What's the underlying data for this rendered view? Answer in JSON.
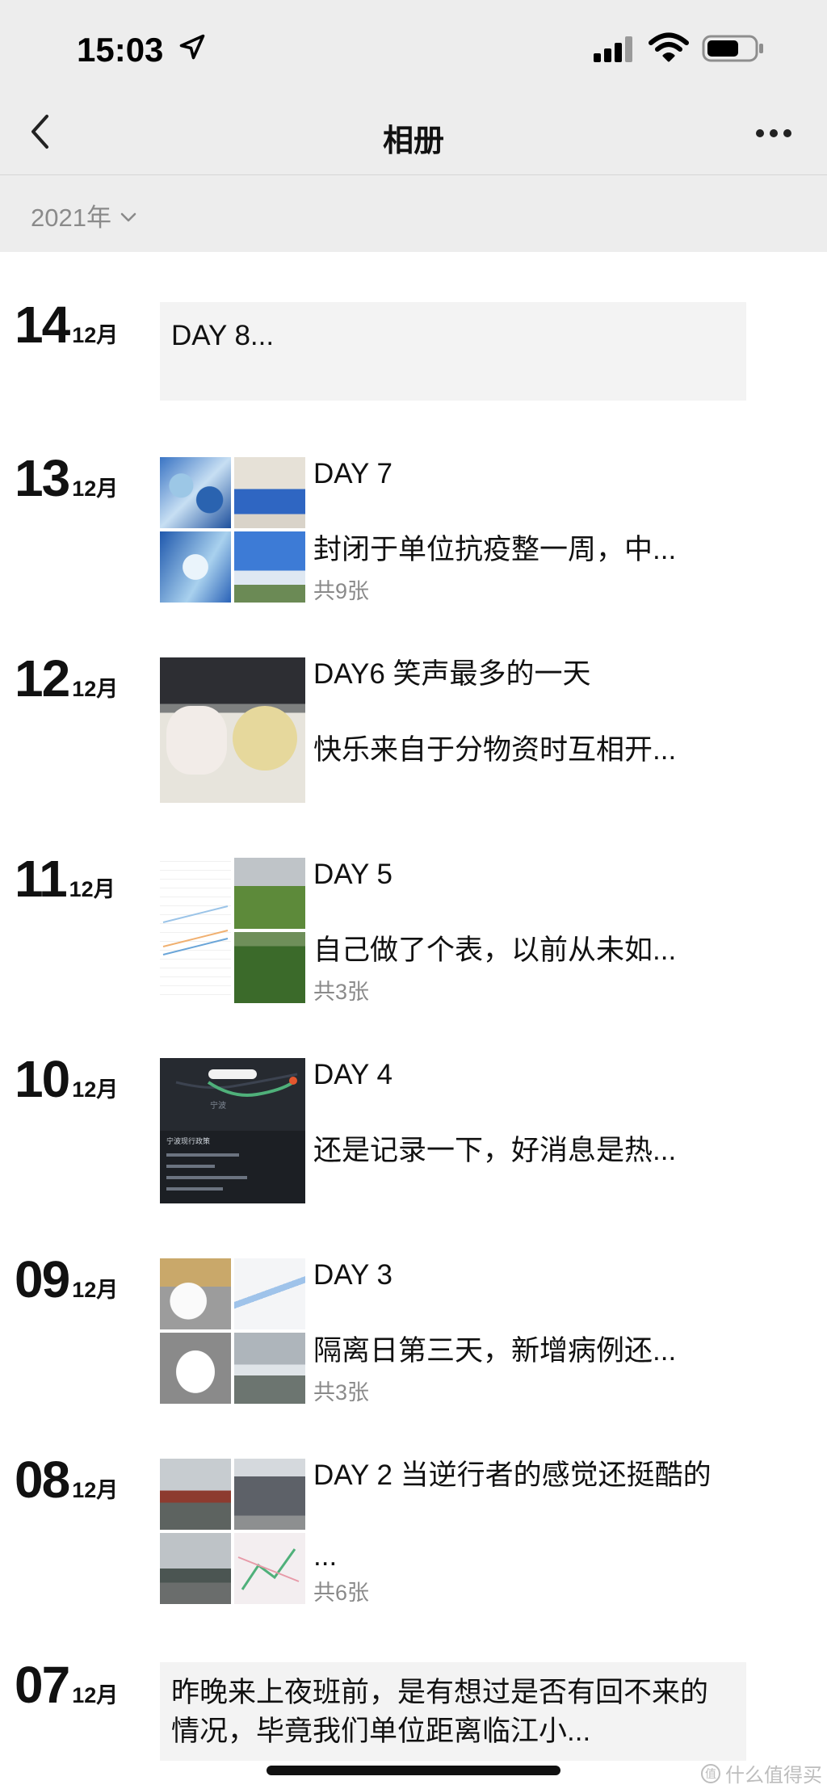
{
  "status_bar": {
    "time": "15:03"
  },
  "header": {
    "title": "相册"
  },
  "filter": {
    "year": "2021年"
  },
  "entries": [
    {
      "day": "14",
      "month": "12月",
      "text": "DAY 8..."
    },
    {
      "day": "13",
      "month": "12月",
      "title": "DAY 7",
      "desc": "封闭于单位抗疫整一周，中...",
      "count": "共9张"
    },
    {
      "day": "12",
      "month": "12月",
      "title": "DAY6 笑声最多的一天",
      "desc": "快乐来自于分物资时互相开..."
    },
    {
      "day": "11",
      "month": "12月",
      "title": "DAY 5",
      "desc": "自己做了个表，以前从未如...",
      "count": "共3张"
    },
    {
      "day": "10",
      "month": "12月",
      "title": "DAY 4",
      "desc": "还是记录一下，好消息是热..."
    },
    {
      "day": "09",
      "month": "12月",
      "title": "DAY 3",
      "desc": "隔离日第三天，新增病例还...",
      "count": "共3张"
    },
    {
      "day": "08",
      "month": "12月",
      "title": "DAY 2 当逆行者的感觉还挺酷的",
      "desc": "...",
      "count": "共6张"
    },
    {
      "day": "07",
      "month": "12月",
      "text": "昨晚来上夜班前，是有想过是否有回不来的情况，毕竟我们单位距离临江小..."
    }
  ],
  "map_labels": {
    "label1": "宁波",
    "label2": "宁波现行政策"
  },
  "watermark": {
    "text": "什么值得买"
  },
  "colors": {
    "background": "#ffffff",
    "header_bg": "#ededed",
    "text_card_bg": "#f3f3f3",
    "muted": "#8a8a8a"
  }
}
